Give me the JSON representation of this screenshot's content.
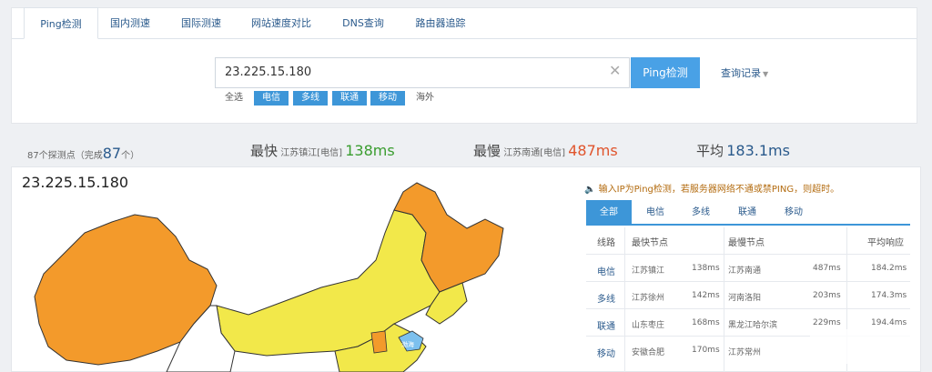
{
  "tabs": [
    "Ping检测",
    "国内测速",
    "国际测速",
    "网站速度对比",
    "DNS查询",
    "路由器追踪"
  ],
  "search": {
    "value": "23.225.15.180",
    "button": "Ping检测",
    "history": "查询记录"
  },
  "filters": {
    "all": "全选",
    "telecom": "电信",
    "multi": "多线",
    "unicom": "联通",
    "mobile": "移动",
    "overseas": "海外"
  },
  "stats": {
    "probe_prefix": "87个探测点（完成",
    "probe_done": "87",
    "probe_suffix": "个）",
    "fastest_label": "最快",
    "fastest_node": "江苏镇江[电信]",
    "fastest_value": "138ms",
    "slowest_label": "最慢",
    "slowest_node": "江苏南通[电信]",
    "slowest_value": "487ms",
    "avg_label": "平均",
    "avg_value": "183.1ms"
  },
  "map": {
    "ip": "23.225.15.180",
    "city_label": "渤海"
  },
  "notice": "输入IP为Ping检测，若服务器网络不通或禁PING，则超时。",
  "result_tabs": [
    "全部",
    "电信",
    "多线",
    "联通",
    "移动"
  ],
  "table": {
    "headers": {
      "line": "线路",
      "fastest": "最快节点",
      "slowest": "最慢节点",
      "avg": "平均响应"
    },
    "rows": [
      {
        "line": "电信",
        "fast_node": "江苏镇江",
        "fast_ms": "138ms",
        "slow_node": "江苏南通",
        "slow_ms": "487ms",
        "avg": "184.2ms"
      },
      {
        "line": "多线",
        "fast_node": "江苏徐州",
        "fast_ms": "142ms",
        "slow_node": "河南洛阳",
        "slow_ms": "203ms",
        "avg": "174.3ms"
      },
      {
        "line": "联通",
        "fast_node": "山东枣庄",
        "fast_ms": "168ms",
        "slow_node": "黑龙江哈尔滨",
        "slow_ms": "229ms",
        "avg": "194.4ms"
      },
      {
        "line": "移动",
        "fast_node": "安徽合肥",
        "fast_ms": "170ms",
        "slow_node": "江苏常州",
        "slow_ms": "",
        "avg": ""
      }
    ]
  },
  "colors": {
    "accent": "#3d96d8",
    "fast": "#3a9d2f",
    "slow": "#e0542c",
    "map_orange": "#f39a2b",
    "map_yellow": "#f2e84a"
  }
}
